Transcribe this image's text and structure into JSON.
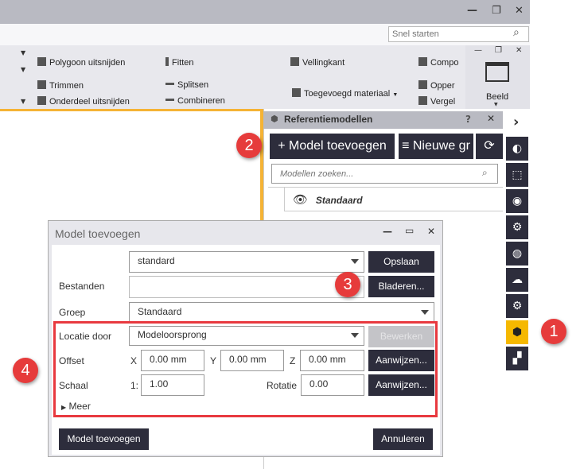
{
  "window": {
    "minimize": "—",
    "restore": "❐",
    "close": "✕"
  },
  "quick_search": {
    "placeholder": "Snel starten"
  },
  "ribbon": {
    "items": [
      "Polygoon uitsnijden",
      "Trimmen",
      "Onderdeel uitsnijden",
      "Fitten",
      "Splitsen",
      "Combineren",
      "Vellingkant",
      "Toegevoegd materiaal",
      "Compo",
      "Opper",
      "Vergel"
    ],
    "view_group": {
      "label": "Beeld"
    }
  },
  "panel": {
    "title": "Referentiemodellen",
    "help": "?",
    "close": "✕",
    "add_model": "+ Model toevoegen",
    "new_group": "≡ Nieuwe gr",
    "search_placeholder": "Modellen zoeken...",
    "tree": [
      {
        "label": "Standaard"
      }
    ]
  },
  "sidebar": {
    "expand": "›",
    "icons": [
      "sync-icon",
      "bounding-box-icon",
      "eye-icon",
      "settings-query-icon",
      "globe-icon",
      "cloud-icon",
      "gear-icon",
      "cube-icon",
      "shapes-icon"
    ],
    "active_index": 7,
    "active_color": "#f5b800"
  },
  "dialog": {
    "title": "Model toevoegen",
    "preset": "standard",
    "save": "Opslaan",
    "files_label": "Bestanden",
    "files_value": "",
    "browse": "Bladeren...",
    "group_label": "Groep",
    "group_value": "Standaard",
    "location_label": "Locatie door",
    "location_value": "Modeloorsprong",
    "edit": "Bewerken",
    "offset_label": "Offset",
    "x_label": "X",
    "x": "0.00 mm",
    "y_label": "Y",
    "y": "0.00 mm",
    "z_label": "Z",
    "z": "0.00 mm",
    "pick1": "Aanwijzen...",
    "scale_label": "Schaal",
    "scale_prefix": "1:",
    "scale": "1.00",
    "rotation_label": "Rotatie",
    "rotation": "0.00",
    "pick2": "Aanwijzen...",
    "more": "Meer",
    "add": "Model toevoegen",
    "cancel": "Annuleren"
  },
  "callouts": [
    "1",
    "2",
    "3",
    "4"
  ],
  "colors": {
    "accent": "#e63b3b",
    "dark": "#2d2d3c",
    "orange": "#f5b335"
  }
}
